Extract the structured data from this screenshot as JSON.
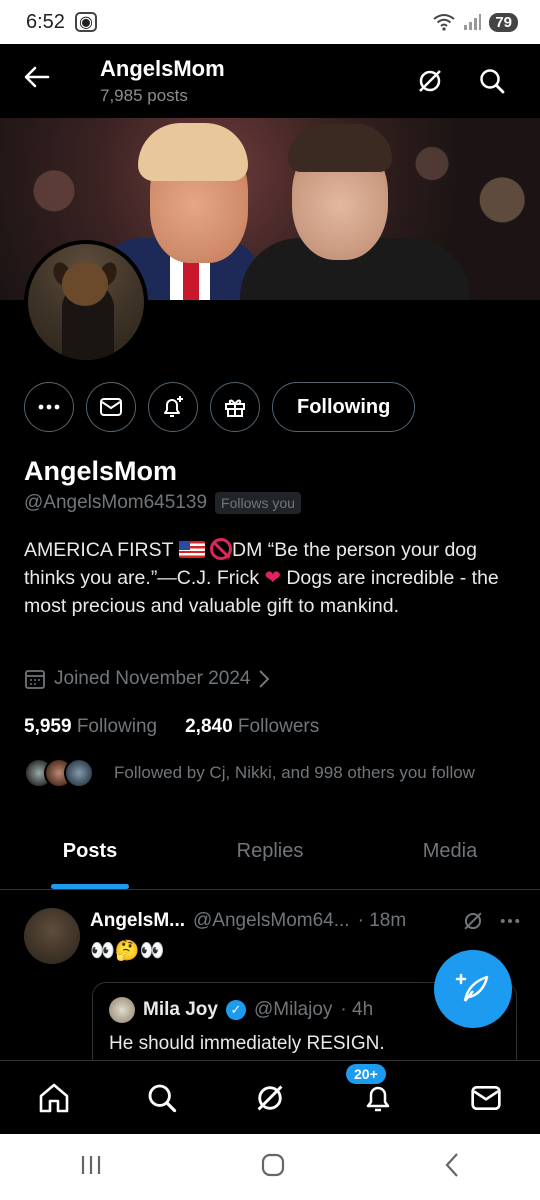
{
  "statusbar": {
    "time": "6:52",
    "battery": "79"
  },
  "header": {
    "title": "AngelsMom",
    "subtitle": "7,985 posts"
  },
  "profile": {
    "name": "AngelsMom",
    "handle": "@AngelsMom645139",
    "follows_badge": "Follows you",
    "following_button": "Following",
    "bio_part1": "AMERICA FIRST ",
    "bio_part2": "DM   “Be the person your dog thinks you are.”—C.J. Frick ",
    "bio_part3": " Dogs are incredible - the most precious and valuable gift to mankind.",
    "joined": "Joined November 2024",
    "following_count": "5,959",
    "following_label": "Following",
    "followers_count": "2,840",
    "followers_label": "Followers",
    "followed_by": "Followed by Cj, Nikki, and 998 others you follow"
  },
  "tabs": [
    "Posts",
    "Replies",
    "Media"
  ],
  "post": {
    "name": "AngelsM...",
    "handle": "@AngelsMom64...",
    "time": "· 18m",
    "text": "👀🤔👀",
    "quote": {
      "name": "Mila Joy",
      "handle": "@Milajoy",
      "time": "· 4h",
      "text": "He should immediately RESIGN."
    }
  },
  "bottomnav": {
    "notifications_badge": "20+"
  },
  "colors": {
    "accent": "#1d9bf0",
    "background": "#000000",
    "muted": "#71767b"
  }
}
